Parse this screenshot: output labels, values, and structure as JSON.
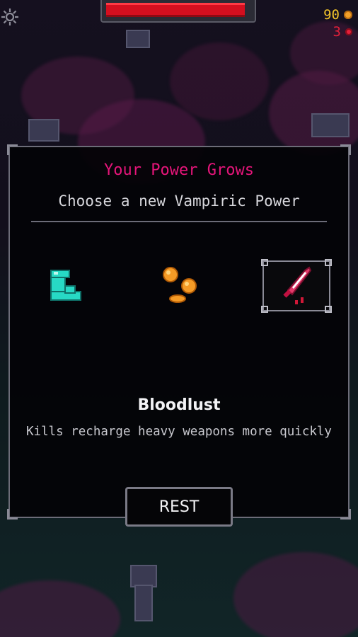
{
  "hud": {
    "settings_icon": "gear-icon",
    "health_fraction": 0.96,
    "coins": "90",
    "coin_icon": "coin-icon",
    "blood": "3",
    "blood_icon": "blood-drop-icon"
  },
  "dialog": {
    "title": "Your Power Grows",
    "subtitle": "Choose a new Vampiric Power",
    "powers": [
      {
        "icon": "boot-icon",
        "selected": false
      },
      {
        "icon": "coins-icon",
        "selected": false
      },
      {
        "icon": "blade-icon",
        "selected": true
      }
    ],
    "selected_name": "Bloodlust",
    "selected_description": "Kills recharge heavy weapons more quickly",
    "button_label": "REST"
  },
  "colors": {
    "title": "#e6157a",
    "health": "#d40f1f",
    "coins": "#f2c42a",
    "blood": "#e2203a"
  }
}
